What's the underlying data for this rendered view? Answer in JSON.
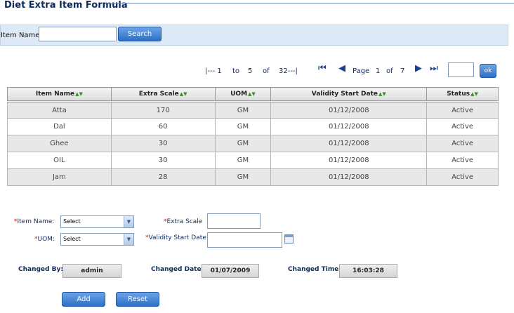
{
  "page": {
    "title": "Diet Extra Item Formula"
  },
  "search": {
    "label": "Item Name:",
    "value": "",
    "button": "Search"
  },
  "pager": {
    "range_start": "|--- 1",
    "to": "to",
    "range_end": "5",
    "of": "of",
    "total": "32---|",
    "page_label": "Page",
    "page_current": "1",
    "page_of": "of",
    "page_total": "7",
    "goto_value": "",
    "ok_label": "ok"
  },
  "table": {
    "columns": [
      "Item Name",
      "Extra Scale",
      "UOM",
      "Validity Start Date",
      "Status"
    ],
    "rows": [
      [
        "Atta",
        "170",
        "GM",
        "01/12/2008",
        "Active"
      ],
      [
        "Dal",
        "60",
        "GM",
        "01/12/2008",
        "Active"
      ],
      [
        "Ghee",
        "30",
        "GM",
        "01/12/2008",
        "Active"
      ],
      [
        "OIL",
        "30",
        "GM",
        "01/12/2008",
        "Active"
      ],
      [
        "Jam",
        "28",
        "GM",
        "01/12/2008",
        "Active"
      ]
    ]
  },
  "form": {
    "item_name_label": "Item Name:",
    "item_name_value": "Select",
    "uom_label": "UOM:",
    "uom_value": "Select",
    "extra_scale_label": "Extra Scale",
    "extra_scale_value": "",
    "validity_label": "Validity Start Date:",
    "validity_value": "",
    "required_marker": "*"
  },
  "audit": {
    "changed_by_label": "Changed By:",
    "changed_by_value": "admin",
    "changed_date_label": "Changed Date:",
    "changed_date_value": "01/07/2009",
    "changed_time_label": "Changed Time:",
    "changed_time_value": "16:03:28"
  },
  "actions": {
    "add": "Add",
    "reset": "Reset"
  },
  "icons": {
    "first": "first-page-icon",
    "prev": "prev-page-icon",
    "next": "next-page-icon",
    "last": "last-page-icon",
    "calendar": "calendar-icon",
    "sort": "sort-arrows-icon"
  }
}
